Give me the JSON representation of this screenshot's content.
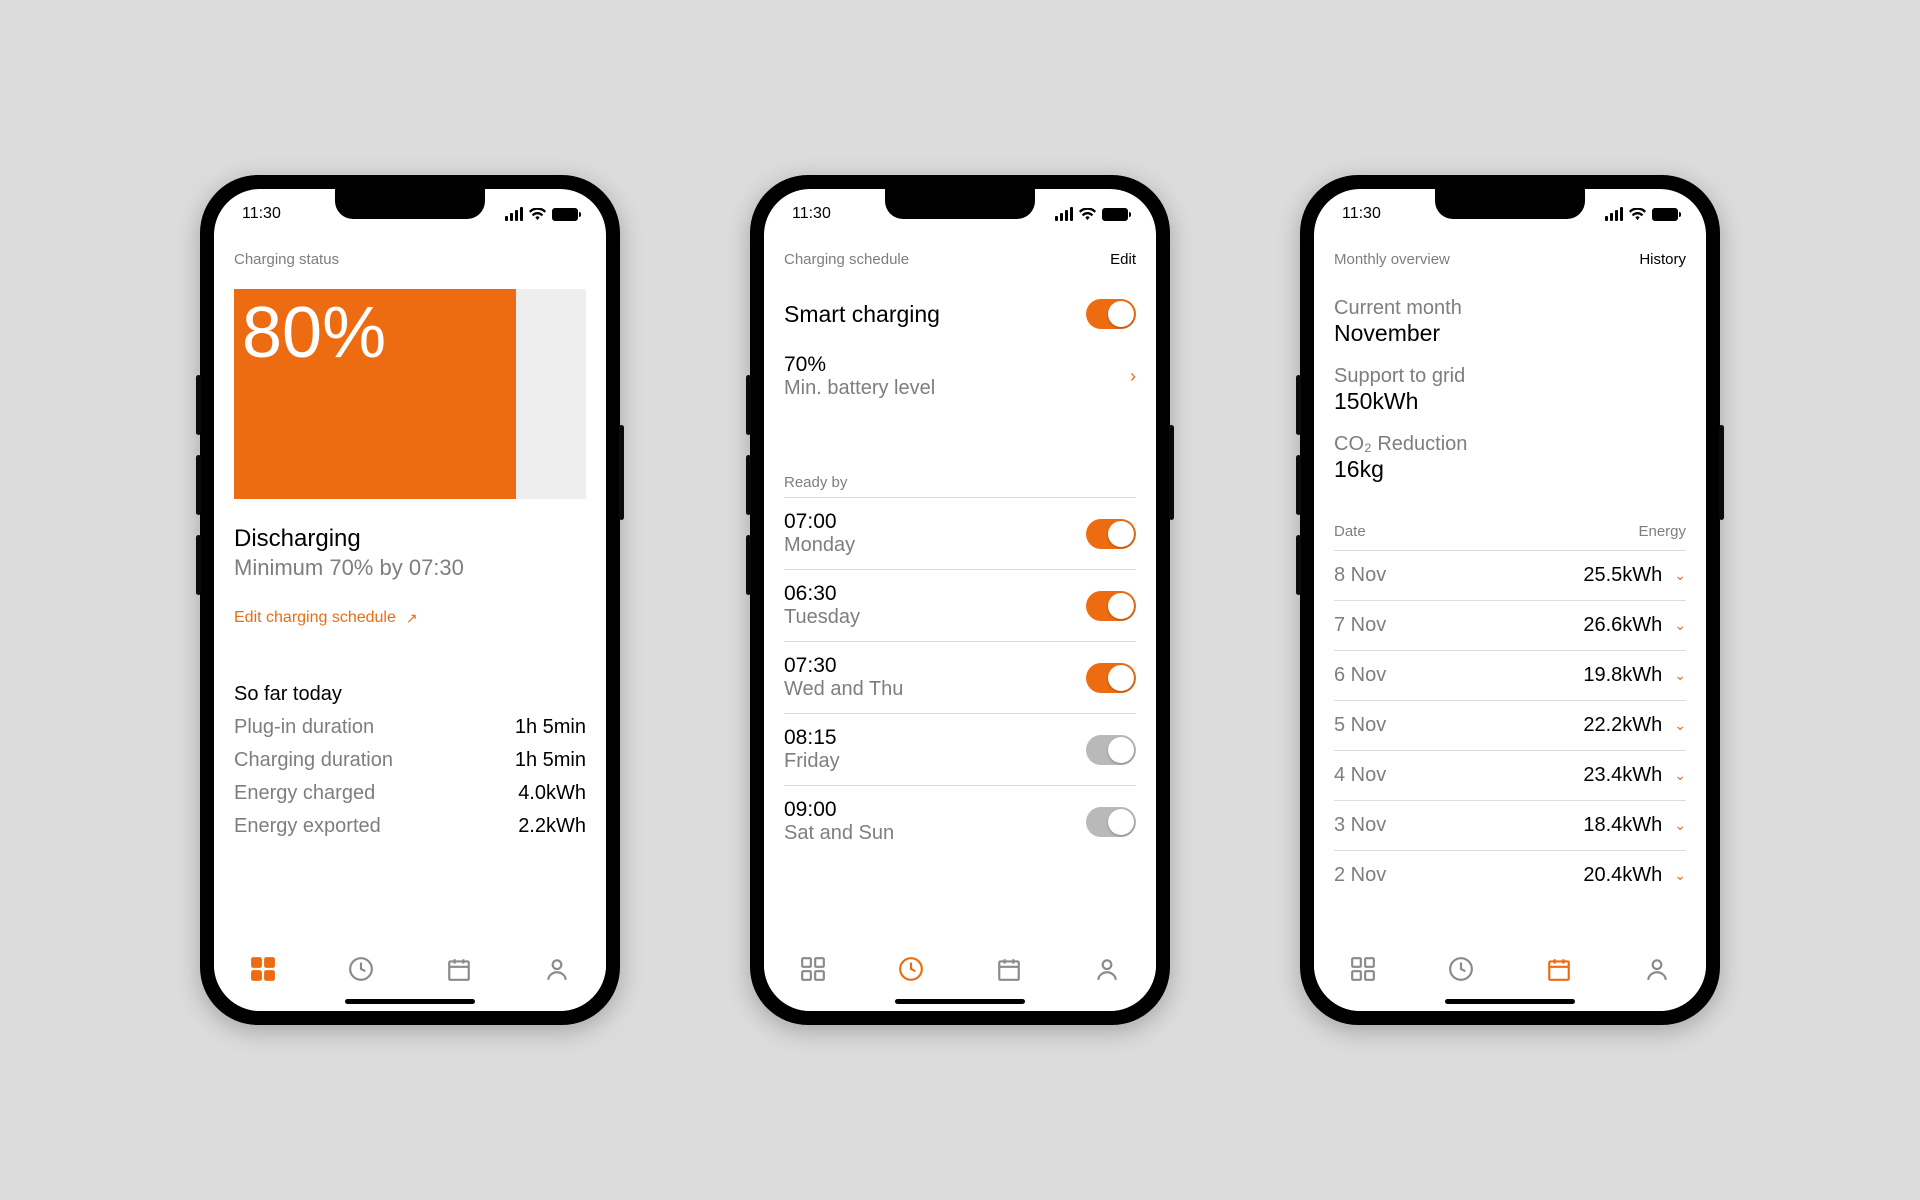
{
  "statusbar": {
    "time": "11:30"
  },
  "colors": {
    "accent": "#ee6c11"
  },
  "status": {
    "header": "Charging status",
    "battery_pct": "80%",
    "state": "Discharging",
    "target_line": "Minimum 70% by 07:30",
    "edit_link": "Edit charging schedule",
    "today_header": "So far today",
    "today_rows": [
      {
        "k": "Plug-in duration",
        "v": "1h 5min"
      },
      {
        "k": "Charging duration",
        "v": "1h 5min"
      },
      {
        "k": "Energy charged",
        "v": "4.0kWh"
      },
      {
        "k": "Energy exported",
        "v": "2.2kWh"
      }
    ]
  },
  "schedule": {
    "header": "Charging schedule",
    "edit": "Edit",
    "smart_label": "Smart charging",
    "smart_on": true,
    "min_level_value": "70%",
    "min_level_label": "Min. battery level",
    "ready_by_header": "Ready by",
    "items": [
      {
        "time": "07:00",
        "days": "Monday",
        "on": true
      },
      {
        "time": "06:30",
        "days": "Tuesday",
        "on": true
      },
      {
        "time": "07:30",
        "days": "Wed and Thu",
        "on": true
      },
      {
        "time": "08:15",
        "days": "Friday",
        "on": false
      },
      {
        "time": "09:00",
        "days": "Sat and Sun",
        "on": false
      }
    ]
  },
  "overview": {
    "header": "Monthly overview",
    "history": "History",
    "stats": [
      {
        "lbl": "Current month",
        "val": "November"
      },
      {
        "lbl": "Support to grid",
        "val": "150kWh"
      },
      {
        "lbl": "CO₂ Reduction",
        "val": "16kg"
      }
    ],
    "col_date": "Date",
    "col_energy": "Energy",
    "rows": [
      {
        "d": "8 Nov",
        "e": "25.5kWh"
      },
      {
        "d": "7 Nov",
        "e": "26.6kWh"
      },
      {
        "d": "6 Nov",
        "e": "19.8kWh"
      },
      {
        "d": "5 Nov",
        "e": "22.2kWh"
      },
      {
        "d": "4 Nov",
        "e": "23.4kWh"
      },
      {
        "d": "3 Nov",
        "e": "18.4kWh"
      },
      {
        "d": "2 Nov",
        "e": "20.4kWh"
      }
    ]
  },
  "nav": {
    "items": [
      "dashboard",
      "clock",
      "calendar",
      "profile"
    ]
  }
}
